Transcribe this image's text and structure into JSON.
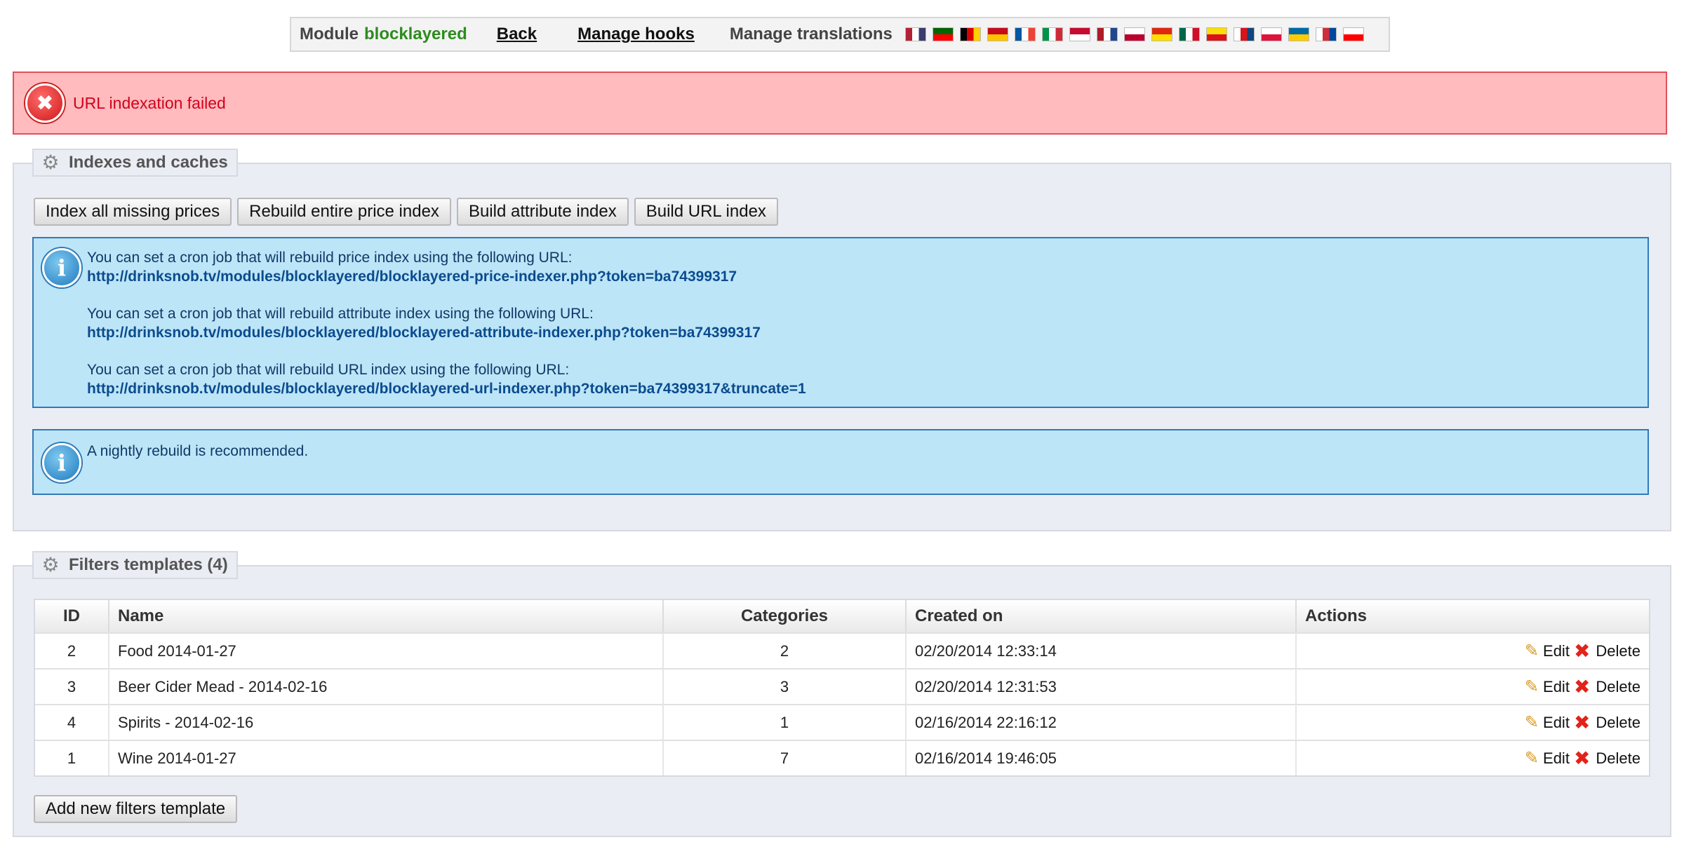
{
  "toolbar": {
    "module_prefix": "Module",
    "module_name": "blocklayered",
    "back": "Back",
    "manage_hooks": "Manage hooks",
    "manage_translations": "Manage translations",
    "flags": [
      {
        "name": "us-flag-icon",
        "colors": [
          "#b22234",
          "#ffffff",
          "#3c3b6e"
        ]
      },
      {
        "name": "portugal-flag-icon",
        "colors": [
          "#006600",
          "#ff0000"
        ]
      },
      {
        "name": "germany-flag-icon",
        "colors": [
          "#000000",
          "#dd0000",
          "#ffce00"
        ]
      },
      {
        "name": "spain-flag-icon",
        "colors": [
          "#c60b1e",
          "#ffc400"
        ]
      },
      {
        "name": "france-flag-icon",
        "colors": [
          "#0055a4",
          "#ffffff",
          "#ef4135"
        ]
      },
      {
        "name": "italy-flag-icon",
        "colors": [
          "#009246",
          "#ffffff",
          "#ce2b37"
        ]
      },
      {
        "name": "denmark-flag-icon",
        "colors": [
          "#c60c30",
          "#ffffff"
        ]
      },
      {
        "name": "netherlands-flag-icon",
        "colors": [
          "#ae1c28",
          "#ffffff",
          "#21468b"
        ]
      },
      {
        "name": "japan-flag-icon",
        "colors": [
          "#ffffff",
          "#bc002d"
        ]
      },
      {
        "name": "china-flag-icon",
        "colors": [
          "#de2910",
          "#ffde00"
        ]
      },
      {
        "name": "mexico-flag-icon",
        "colors": [
          "#006847",
          "#ffffff",
          "#ce1126"
        ]
      },
      {
        "name": "catalonia-flag-icon",
        "colors": [
          "#fcdd09",
          "#da121a"
        ]
      },
      {
        "name": "czech-flag-icon",
        "colors": [
          "#ffffff",
          "#d7141a",
          "#11457e"
        ]
      },
      {
        "name": "poland-flag-icon",
        "colors": [
          "#ffffff",
          "#dc143c"
        ]
      },
      {
        "name": "sweden-flag-icon",
        "colors": [
          "#006aa7",
          "#fecc00"
        ]
      },
      {
        "name": "korea-flag-icon",
        "colors": [
          "#ffffff",
          "#cd2e3a",
          "#0047a0"
        ]
      },
      {
        "name": "georgia-flag-icon",
        "colors": [
          "#ffffff",
          "#ff0000"
        ]
      }
    ]
  },
  "error": {
    "message": "URL indexation failed"
  },
  "indexes": {
    "legend": "Indexes and caches",
    "buttons": {
      "index_missing": "Index all missing prices",
      "rebuild_price": "Rebuild entire price index",
      "build_attribute": "Build attribute index",
      "build_url": "Build URL index"
    },
    "cron": {
      "price_text": "You can set a cron job that will rebuild price index using the following URL:",
      "price_url": "http://drinksnob.tv/modules/blocklayered/blocklayered-price-indexer.php?token=ba74399317",
      "attribute_text": "You can set a cron job that will rebuild attribute index using the following URL:",
      "attribute_url": "http://drinksnob.tv/modules/blocklayered/blocklayered-attribute-indexer.php?token=ba74399317",
      "url_text": "You can set a cron job that will rebuild URL index using the following URL:",
      "url_url": "http://drinksnob.tv/modules/blocklayered/blocklayered-url-indexer.php?token=ba74399317&truncate=1"
    },
    "nightly": "A nightly rebuild is recommended."
  },
  "filters": {
    "legend": "Filters templates (4)",
    "columns": {
      "id": "ID",
      "name": "Name",
      "categories": "Categories",
      "created": "Created on",
      "actions": "Actions"
    },
    "rows": [
      {
        "id": "2",
        "name": "Food 2014-01-27",
        "categories": "2",
        "created": "02/20/2014 12:33:14"
      },
      {
        "id": "3",
        "name": "Beer Cider Mead - 2014-02-16",
        "categories": "3",
        "created": "02/20/2014 12:31:53"
      },
      {
        "id": "4",
        "name": "Spirits - 2014-02-16",
        "categories": "1",
        "created": "02/16/2014 22:16:12"
      },
      {
        "id": "1",
        "name": "Wine 2014-01-27",
        "categories": "7",
        "created": "02/16/2014 19:46:05"
      }
    ],
    "edit_label": "Edit",
    "delete_label": "Delete",
    "add_button": "Add new filters template"
  }
}
